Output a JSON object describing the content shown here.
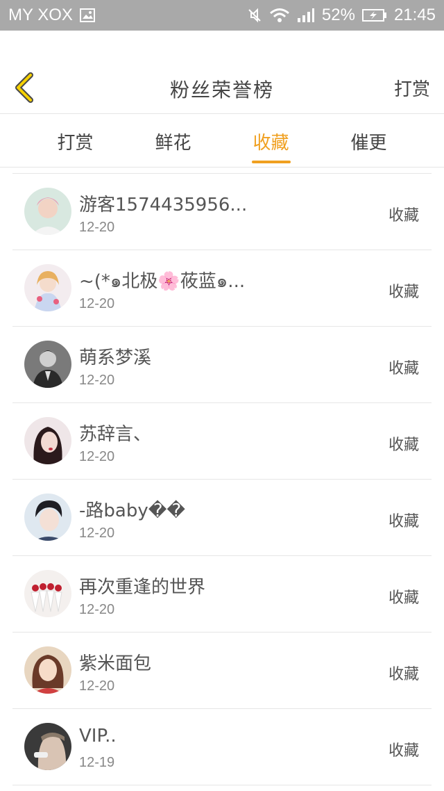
{
  "status_bar": {
    "carrier": "MY XOX",
    "battery": "52%",
    "time": "21:45"
  },
  "header": {
    "title": "粉丝荣誉榜",
    "action": "打赏"
  },
  "tabs": [
    {
      "label": "打赏",
      "active": false
    },
    {
      "label": "鲜花",
      "active": false
    },
    {
      "label": "收藏",
      "active": true
    },
    {
      "label": "催更",
      "active": false
    }
  ],
  "colors": {
    "accent": "#f0a020",
    "status_bar_bg": "#a9a9a9"
  },
  "rows": [
    {
      "name": "游客1574435956...",
      "date": "12-20",
      "type": "收藏"
    },
    {
      "name": "~(*๑北极🌸莜蓝๑...",
      "date": "12-20",
      "type": "收藏"
    },
    {
      "name": "萌系梦溪",
      "date": "12-20",
      "type": "收藏"
    },
    {
      "name": "苏辞言、",
      "date": "12-20",
      "type": "收藏"
    },
    {
      "name": "-路baby��",
      "date": "12-20",
      "type": "收藏"
    },
    {
      "name": "再次重逢的世界",
      "date": "12-20",
      "type": "收藏"
    },
    {
      "name": "紫米面包",
      "date": "12-20",
      "type": "收藏"
    },
    {
      "name": "VIP..",
      "date": "12-19",
      "type": "收藏"
    }
  ]
}
